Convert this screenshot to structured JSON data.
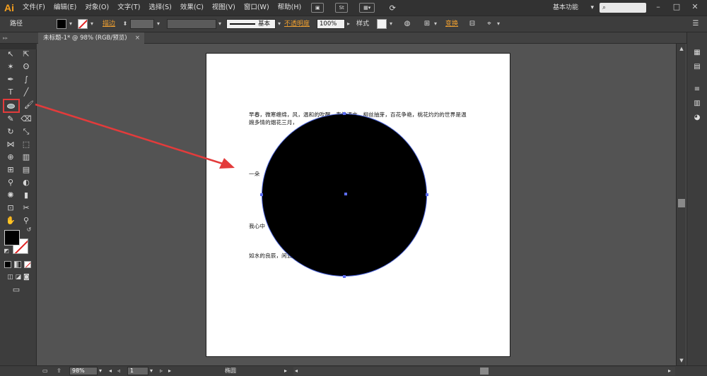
{
  "app": {
    "logo": "Ai"
  },
  "menubar": {
    "items": [
      "文件(F)",
      "编辑(E)",
      "对象(O)",
      "文字(T)",
      "选择(S)",
      "效果(C)",
      "视图(V)",
      "窗口(W)",
      "帮助(H)"
    ],
    "icons": [
      "br-icon",
      "st-icon",
      "arrange-icon",
      "sync-icon"
    ],
    "st_label": "St",
    "workspace": "基本功能",
    "search_icon": "⌕",
    "window_buttons": [
      "–",
      "□",
      "✕"
    ]
  },
  "controlbar": {
    "object_type": "路径",
    "stroke_label": "描边",
    "brush_label": "基本",
    "opacity_label": "不透明度",
    "opacity_value": "100%",
    "style_label": "样式",
    "transform_label": "变换"
  },
  "document": {
    "tab_title": "未标题-1* @ 98% (RGB/预览)",
    "close_glyph": "×"
  },
  "artboard": {
    "paragraphs": [
      "早春，微寒缠绵，风，温和的吹醒，春的语言，柳丝抽芽，百花争艳，桃花灼灼的世界是温婉多情的烟花三月，",
      "一朵",
      "我心中",
      "如水的良辰，闲云"
    ]
  },
  "statusbar": {
    "zoom": "98%",
    "page": "1",
    "tool_name": "椭圆"
  },
  "colors": {
    "fill": "#000000",
    "stroke": "none",
    "selection": "#4a63d8",
    "annotation": "#e33b3b"
  }
}
